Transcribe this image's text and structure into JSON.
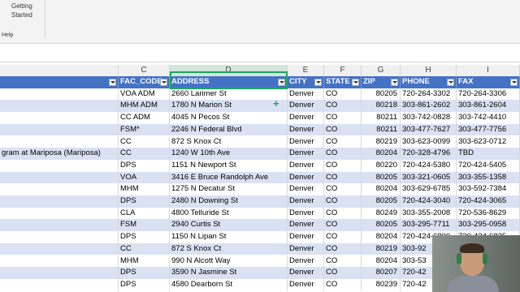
{
  "ribbon": {
    "getting_started": "Getting Started",
    "group_label": "Help"
  },
  "columns": [
    "C",
    "D",
    "E",
    "F",
    "G",
    "H",
    "I"
  ],
  "table": {
    "headers": [
      "FAC_CODE",
      "ADDRESS",
      "CITY",
      "STATE",
      "ZIP",
      "PHONE",
      "FAX"
    ],
    "rows": [
      [
        "",
        "VOA ADM",
        "2660 Larimer St",
        "Denver",
        "CO",
        "80205",
        "720-264-3302",
        "720-264-3306"
      ],
      [
        "",
        "MHM ADM",
        "1780 N Marion St",
        "Denver",
        "CO",
        "80218",
        "303-861-2602",
        "303-861-2604"
      ],
      [
        "",
        "CC ADM",
        "4045 N Pecos St",
        "Denver",
        "CO",
        "80211",
        "303-742-0828",
        "303-742-4410"
      ],
      [
        "",
        "FSM*",
        "2246 N Federal Blvd",
        "Denver",
        "CO",
        "80211",
        "303-477-7627",
        "303-477-7756"
      ],
      [
        "",
        "CC",
        "872 S Knox Ct",
        "Denver",
        "CO",
        "80219",
        "303-623-0099",
        "303-623-0712"
      ],
      [
        "gram at Mariposa (Mariposa)",
        "CC",
        "1240 W 10th Ave",
        "Denver",
        "CO",
        "80204",
        "720-328-4796",
        "TBD"
      ],
      [
        "",
        "DPS",
        "1151 N Newport St",
        "Denver",
        "CO",
        "80220",
        "720-424-5380",
        "720-424-5405"
      ],
      [
        "",
        "VOA",
        "3416 E Bruce Randolph Ave",
        "Denver",
        "CO",
        "80205",
        "303-321-0605",
        "303-355-1358"
      ],
      [
        "",
        "MHM",
        "1275 N Decatur St",
        "Denver",
        "CO",
        "80204",
        "303-629-6785",
        "303-592-7384"
      ],
      [
        "",
        "DPS",
        "2480 N Downing St",
        "Denver",
        "CO",
        "80205",
        "720-424-3040",
        "720-424-3065"
      ],
      [
        "",
        "CLA",
        "4800 Telluride St",
        "Denver",
        "CO",
        "80249",
        "303-355-2008",
        "720-536-8629"
      ],
      [
        "",
        "FSM",
        "2940 Curtis St",
        "Denver",
        "CO",
        "80205",
        "303-295-7711",
        "303-295-0958"
      ],
      [
        "",
        "DPS",
        "1150 N Lipan St",
        "Denver",
        "CO",
        "80204",
        "720-424-6800",
        "720-424-6825"
      ],
      [
        "",
        "CC",
        "872 S Knox Ct",
        "Denver",
        "CO",
        "80219",
        "303-92",
        ""
      ],
      [
        "",
        "MHM",
        "990 N Alcott Way",
        "Denver",
        "CO",
        "80204",
        "303-53",
        ""
      ],
      [
        "",
        "DPS",
        "3590 N Jasmine St",
        "Denver",
        "CO",
        "80207",
        "720-42",
        ""
      ],
      [
        "",
        "DPS",
        "4580 Dearborn St",
        "Denver",
        "CO",
        "80239",
        "720-42",
        ""
      ]
    ]
  }
}
